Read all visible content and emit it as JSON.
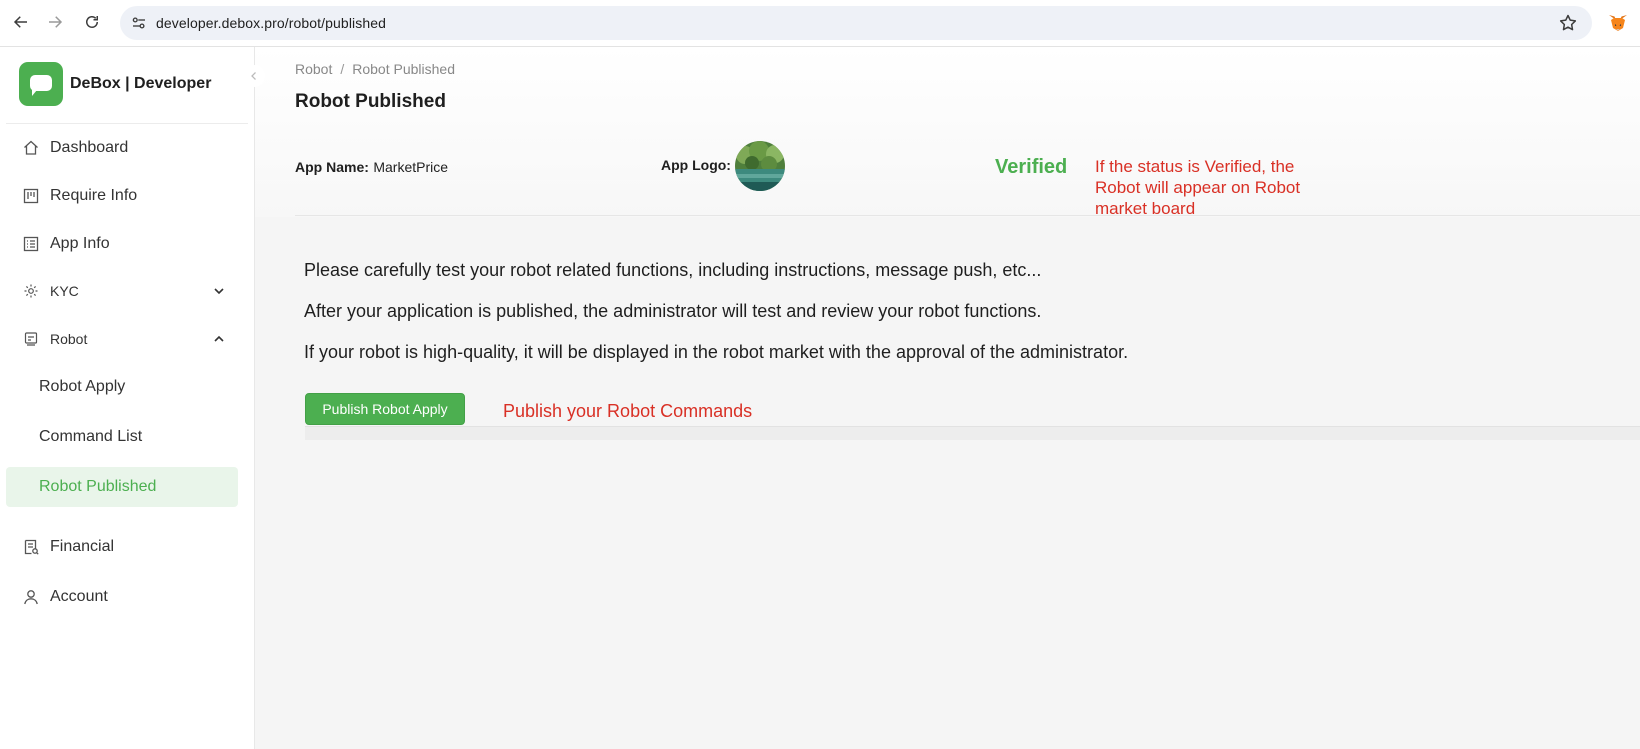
{
  "browser": {
    "url": "developer.debox.pro/robot/published"
  },
  "brand": {
    "name": "DeBox | Developer",
    "color": "#4caf50"
  },
  "sidebar": {
    "items": [
      {
        "label": "Dashboard",
        "icon": "home-icon"
      },
      {
        "label": "Require Info",
        "icon": "kanban-icon"
      },
      {
        "label": "App Info",
        "icon": "list-icon"
      },
      {
        "label": "KYC",
        "icon": "gear-icon",
        "expanded": false
      },
      {
        "label": "Robot",
        "icon": "robot-icon",
        "expanded": true
      },
      {
        "label": "Robot Apply"
      },
      {
        "label": "Command List"
      },
      {
        "label": "Robot Published",
        "active": true
      },
      {
        "label": "Financial",
        "icon": "receipt-icon"
      },
      {
        "label": "Account",
        "icon": "user-icon"
      }
    ]
  },
  "breadcrumb": {
    "parent": "Robot",
    "separator": "/",
    "current": "Robot Published"
  },
  "page": {
    "title": "Robot Published",
    "app_name_label": "App Name:",
    "app_name_value": "MarketPrice",
    "app_logo_label": "App Logo:",
    "status": "Verified",
    "status_color": "#4caf50",
    "status_note": "If the status is Verified, the Robot will appear on Robot market board",
    "paragraphs": [
      "Please carefully test your robot related functions, including instructions, message push, etc...",
      "After your application is published, the administrator will test and review your robot functions.",
      "If your robot is high-quality, it will be displayed in the robot market with the approval of the administrator."
    ],
    "publish_button": "Publish Robot Apply",
    "publish_note": "Publish your Robot Commands",
    "note_color": "#d93025"
  }
}
